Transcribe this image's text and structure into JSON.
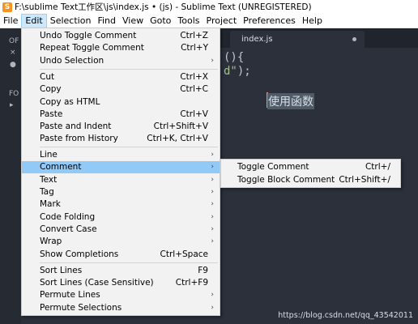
{
  "window": {
    "title": "F:\\sublime Text工作区\\js\\index.js • (js) - Sublime Text (UNREGISTERED)",
    "icon_letter": "S"
  },
  "menubar": [
    "File",
    "Edit",
    "Selection",
    "Find",
    "View",
    "Goto",
    "Tools",
    "Project",
    "Preferences",
    "Help"
  ],
  "sidebar": {
    "open_files_label": "OF",
    "folders_label": "FO"
  },
  "tab": {
    "name": "index.js"
  },
  "editor": {
    "line1": "(){",
    "line2_str": "d\"",
    "line2_end": ");",
    "selected_text": "使用函数"
  },
  "watermark": "https://blog.csdn.net/qq_43542011",
  "edit_menu": {
    "undo_toggle_comment": "Undo Toggle Comment",
    "undo_toggle_comment_sc": "Ctrl+Z",
    "repeat_toggle_comment": "Repeat Toggle Comment",
    "repeat_toggle_comment_sc": "Ctrl+Y",
    "undo_selection": "Undo Selection",
    "cut": "Cut",
    "cut_sc": "Ctrl+X",
    "copy": "Copy",
    "copy_sc": "Ctrl+C",
    "copy_as_html": "Copy as HTML",
    "paste": "Paste",
    "paste_sc": "Ctrl+V",
    "paste_and_indent": "Paste and Indent",
    "paste_and_indent_sc": "Ctrl+Shift+V",
    "paste_from_history": "Paste from History",
    "paste_from_history_sc": "Ctrl+K, Ctrl+V",
    "line": "Line",
    "comment": "Comment",
    "text": "Text",
    "tag": "Tag",
    "mark": "Mark",
    "code_folding": "Code Folding",
    "convert_case": "Convert Case",
    "wrap": "Wrap",
    "show_completions": "Show Completions",
    "show_completions_sc": "Ctrl+Space",
    "sort_lines": "Sort Lines",
    "sort_lines_sc": "F9",
    "sort_lines_case": "Sort Lines (Case Sensitive)",
    "sort_lines_case_sc": "Ctrl+F9",
    "permute_lines": "Permute Lines",
    "permute_selections": "Permute Selections"
  },
  "comment_submenu": {
    "toggle_comment": "Toggle Comment",
    "toggle_comment_sc": "Ctrl+/",
    "toggle_block_comment": "Toggle Block Comment",
    "toggle_block_comment_sc": "Ctrl+Shift+/"
  },
  "colors": {
    "highlight": "#91c9f7",
    "menu_bg": "#f2f2f2",
    "editor_bg": "#2b303b",
    "cursor": "#f99157"
  }
}
